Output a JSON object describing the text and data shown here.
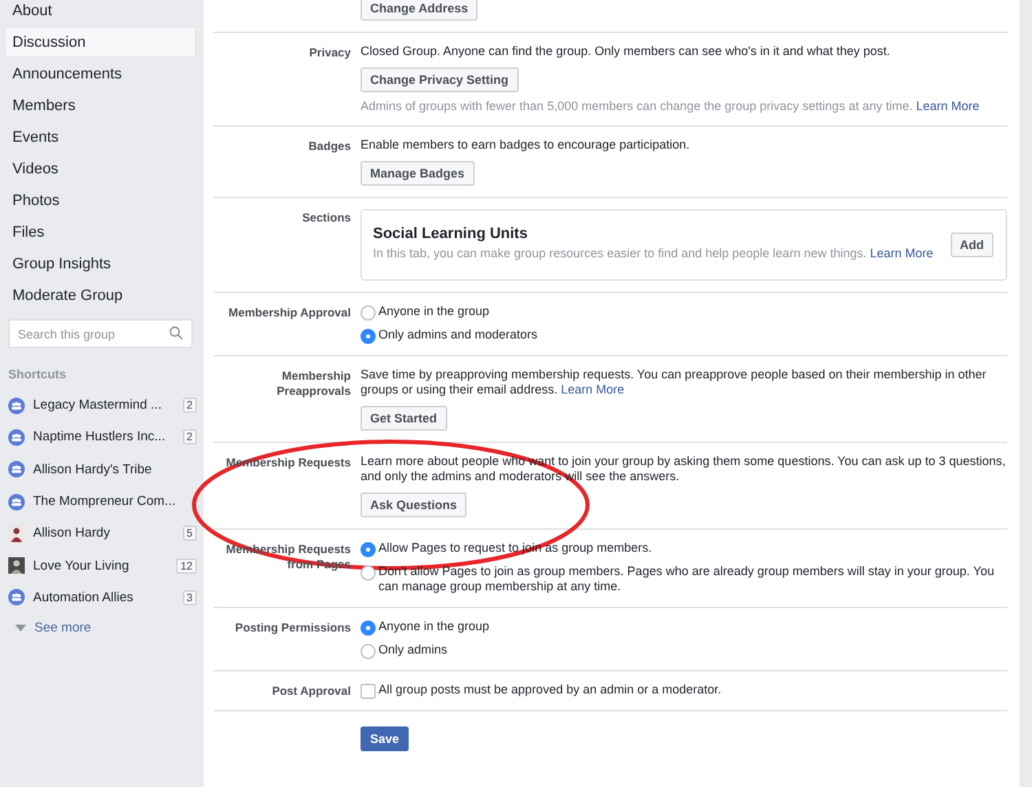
{
  "sidebar": {
    "items": [
      {
        "label": "About",
        "selected": false
      },
      {
        "label": "Discussion",
        "selected": true
      },
      {
        "label": "Announcements",
        "selected": false
      },
      {
        "label": "Members",
        "selected": false
      },
      {
        "label": "Events",
        "selected": false
      },
      {
        "label": "Videos",
        "selected": false
      },
      {
        "label": "Photos",
        "selected": false
      },
      {
        "label": "Files",
        "selected": false
      },
      {
        "label": "Group Insights",
        "selected": false
      },
      {
        "label": "Moderate Group",
        "selected": false
      }
    ],
    "search": {
      "placeholder": "Search this group"
    },
    "shortcuts_title": "Shortcuts",
    "shortcuts": [
      {
        "label": "Legacy Mastermind ...",
        "kind": "group",
        "count": "2"
      },
      {
        "label": "Naptime Hustlers Inc...",
        "kind": "group",
        "count": "2"
      },
      {
        "label": "Allison Hardy's Tribe",
        "kind": "group"
      },
      {
        "label": "The Mompreneur Com...",
        "kind": "group"
      },
      {
        "label": "Allison Hardy",
        "kind": "person",
        "count": "5"
      },
      {
        "label": "Love Your Living",
        "kind": "page",
        "count": "12"
      },
      {
        "label": "Automation Allies",
        "kind": "group",
        "count": "3"
      }
    ],
    "see_more": "See more"
  },
  "settings": [
    {
      "kind": "action",
      "button": "Change Address"
    },
    {
      "kind": "action",
      "label": "Privacy",
      "text": "Closed Group. Anyone can find the group. Only members can see who's in it and what they post.",
      "button": "Change Privacy Setting",
      "note": "Admins of groups with fewer than 5,000 members can change the group privacy settings at any time.",
      "note_link": "Learn More"
    },
    {
      "kind": "action",
      "label": "Badges",
      "text": "Enable members to earn badges to encourage participation.",
      "button": "Manage Badges"
    },
    {
      "kind": "card",
      "label": "Sections",
      "card": {
        "title": "Social Learning Units",
        "text": "In this tab, you can make group resources easier to find and help people learn new things.",
        "link": "Learn More",
        "button": "Add"
      }
    },
    {
      "kind": "radio",
      "label": "Membership Approval",
      "options": [
        {
          "label": "Anyone in the group",
          "selected": false
        },
        {
          "label": "Only admins and moderators",
          "selected": true
        }
      ]
    },
    {
      "kind": "action",
      "label": "Membership Preapprovals",
      "text": "Save time by preapproving membership requests. You can preapprove people based on their membership in other groups or using their email address.",
      "link": "Learn More",
      "button": "Get Started"
    },
    {
      "kind": "action",
      "label": "Membership Requests",
      "text": "Learn more about people who want to join your group by asking them some questions. You can ask up to 3 questions, and only the admins and moderators will see the answers.",
      "button": "Ask Questions"
    },
    {
      "kind": "radio",
      "label": "Membership Requests from Pages",
      "options": [
        {
          "label": "Allow Pages to request to join as group members.",
          "selected": true
        },
        {
          "label": "Don't allow Pages to join as group members. Pages who are already group members will stay in your group. You can manage group membership at any time.",
          "selected": false
        }
      ]
    },
    {
      "kind": "radio",
      "label": "Posting Permissions",
      "options": [
        {
          "label": "Anyone in the group",
          "selected": true
        },
        {
          "label": "Only admins",
          "selected": false
        }
      ]
    },
    {
      "kind": "checkbox",
      "label": "Post Approval",
      "text": "All group posts must be approved by an admin or a moderator.",
      "checked": false
    }
  ],
  "save_button": "Save",
  "annotation": {
    "kind": "ellipse",
    "color": "#e8262a"
  }
}
